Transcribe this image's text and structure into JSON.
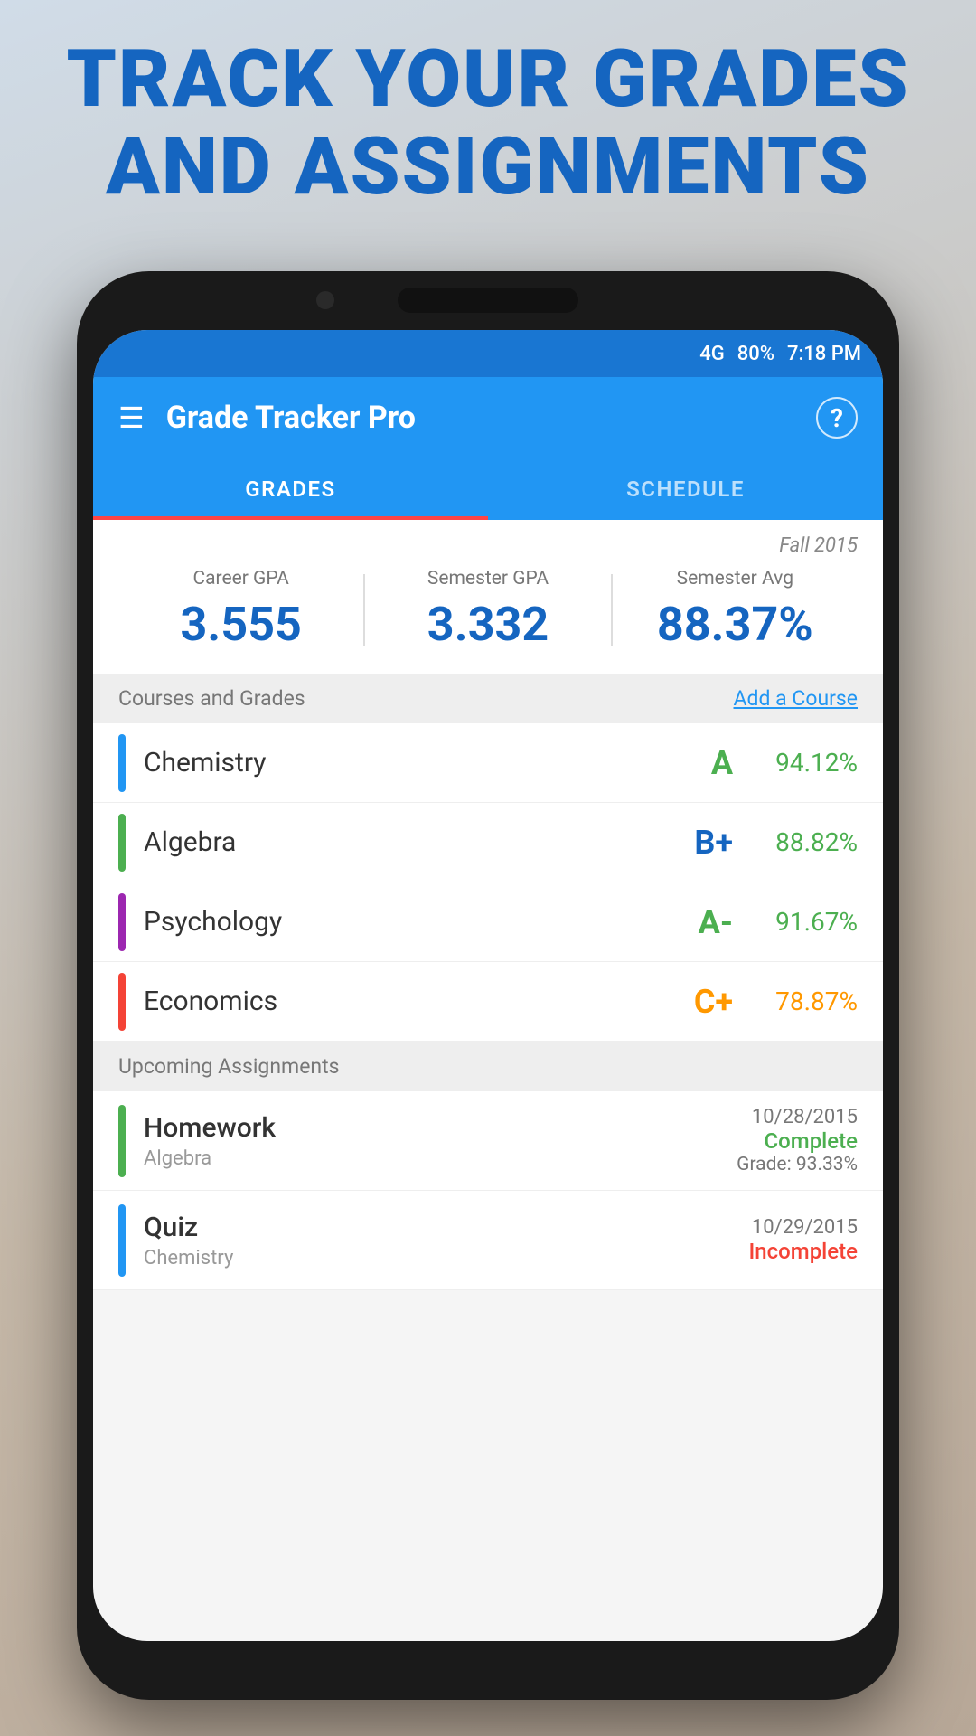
{
  "hero": {
    "line1": "TRACK YOUR GRADES",
    "line2": "AND ASSIGNMENTS"
  },
  "statusBar": {
    "signal": "4G",
    "battery": "80%",
    "time": "7:18 PM"
  },
  "appBar": {
    "title": "Grade Tracker Pro",
    "helpIcon": "?"
  },
  "tabs": [
    {
      "label": "GRADES",
      "active": true
    },
    {
      "label": "SCHEDULE",
      "active": false
    }
  ],
  "semester": "Fall 2015",
  "gpa": {
    "career": {
      "label": "Career GPA",
      "value": "3.555"
    },
    "semester": {
      "label": "Semester GPA",
      "value": "3.332"
    },
    "semesterAvg": {
      "label": "Semester Avg",
      "value": "88.37%"
    }
  },
  "coursesSection": {
    "title": "Courses and Grades",
    "addLink": "Add a Course"
  },
  "courses": [
    {
      "name": "Chemistry",
      "color": "#2196F3",
      "gradeLetter": "A",
      "gradeLetterColor": "#4CAF50",
      "gradePct": "94.12%",
      "pctColor": "green"
    },
    {
      "name": "Algebra",
      "color": "#4CAF50",
      "gradeLetter": "B+",
      "gradeLetterColor": "#1565C0",
      "gradePct": "88.82%",
      "pctColor": "green"
    },
    {
      "name": "Psychology",
      "color": "#9C27B0",
      "gradeLetter": "A-",
      "gradeLetterColor": "#4CAF50",
      "gradePct": "91.67%",
      "pctColor": "green"
    },
    {
      "name": "Economics",
      "color": "#F44336",
      "gradeLetter": "C+",
      "gradeLetterColor": "#FF9800",
      "gradePct": "78.87%",
      "pctColor": "orange"
    }
  ],
  "assignmentsSection": {
    "title": "Upcoming Assignments"
  },
  "assignments": [
    {
      "name": "Homework",
      "course": "Algebra",
      "color": "#4CAF50",
      "date": "10/28/2015",
      "status": "Complete",
      "statusType": "complete",
      "grade": "Grade: 93.33%"
    },
    {
      "name": "Quiz",
      "course": "Chemistry",
      "color": "#2196F3",
      "date": "10/29/2015",
      "status": "Incomplete",
      "statusType": "incomplete",
      "grade": ""
    }
  ]
}
